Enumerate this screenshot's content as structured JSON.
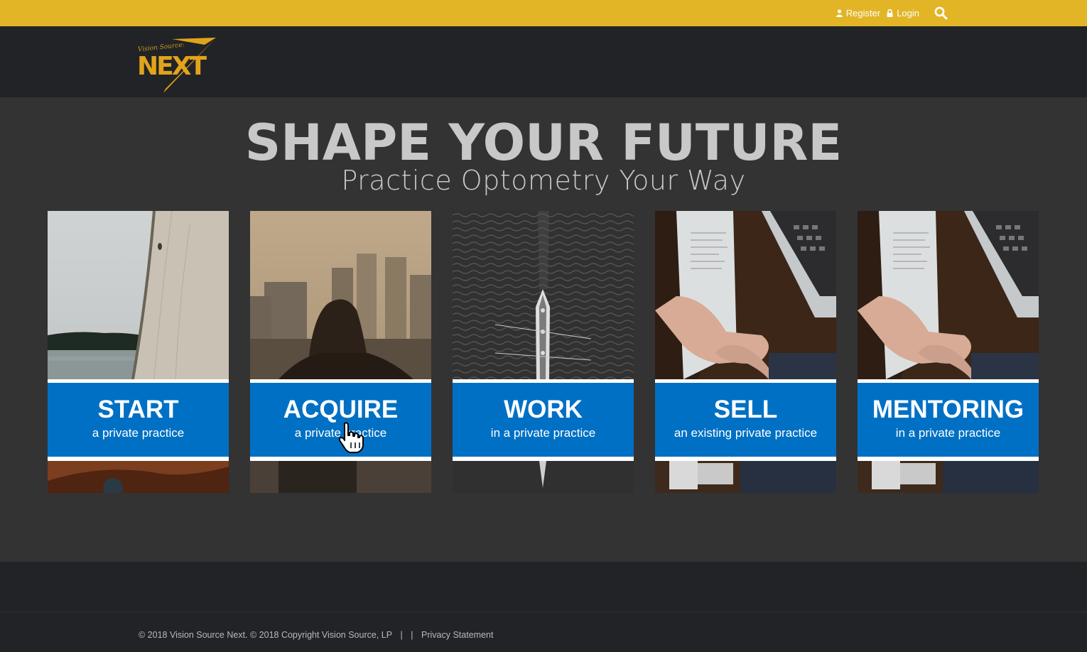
{
  "topbar": {
    "register_label": "Register",
    "login_label": "Login"
  },
  "logo": {
    "small_text": "Vision Source:",
    "big_text": "NEXT"
  },
  "hero": {
    "title": "SHAPE YOUR FUTURE",
    "subtitle": "Practice Optometry Your Way"
  },
  "cards": [
    {
      "title": "START",
      "subtitle": "a private practice"
    },
    {
      "title": "ACQUIRE",
      "subtitle": "a private practice"
    },
    {
      "title": "WORK",
      "subtitle": "in a private practice"
    },
    {
      "title": "SELL",
      "subtitle": "an existing private practice"
    },
    {
      "title": "MENTORING",
      "subtitle": "in a private practice"
    }
  ],
  "footer": {
    "copyright": "© 2018 Vision Source Next. © 2018 Copyright Vision Source, LP",
    "separator_1": "|",
    "separator_2": "|",
    "privacy_label": "Privacy Statement"
  },
  "colors": {
    "topbar": "#e2b526",
    "header": "#212326",
    "hero_bg": "#333333",
    "card_band": "#0070c4",
    "title_text": "#c8c8c8"
  }
}
